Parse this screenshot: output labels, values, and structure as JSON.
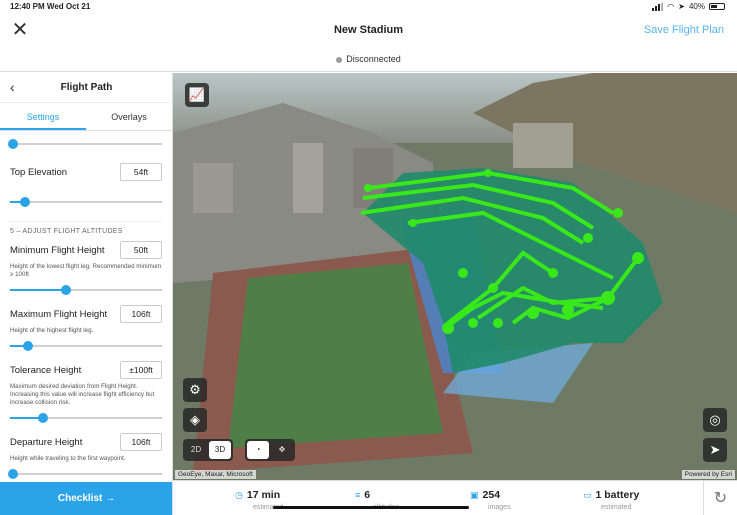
{
  "status_bar": {
    "time_date": "12:40 PM  Wed Oct 21",
    "battery": "40%"
  },
  "header": {
    "title": "New Stadium",
    "save_label": "Save Flight Plan",
    "connection": "Disconnected"
  },
  "sidebar": {
    "title": "Flight Path",
    "tabs": [
      {
        "label": "Settings",
        "active": true
      },
      {
        "label": "Overlays",
        "active": false
      }
    ],
    "sliders": {
      "top": 0.02,
      "top_elevation": 0.1,
      "min_height": 0.37,
      "max_height": 0.12,
      "tolerance": 0.22,
      "departure": 0.02
    },
    "top_elevation": {
      "label": "Top Elevation",
      "value": "54ft"
    },
    "section_title": "5 – ADJUST FLIGHT ALTITUDES",
    "min_height": {
      "label": "Minimum Flight Height",
      "value": "50ft",
      "desc": "Height of the lowest flight leg. Recommended minimum ≥ 100ft"
    },
    "max_height": {
      "label": "Maximum Flight Height",
      "value": "106ft",
      "desc": "Height of the highest flight leg."
    },
    "tolerance": {
      "label": "Tolerance Height",
      "value": "±100ft",
      "desc": "Maximum desired deviation from Flight Height. Increasing this value will increase flight efficiency but increase collision risk."
    },
    "departure": {
      "label": "Departure Height",
      "value": "106ft",
      "desc": "Height while traveling to the first waypoint."
    },
    "checklist_label": "Checklist →"
  },
  "map": {
    "mode_2d": "2D",
    "mode_3d": "3D",
    "active_mode": "3D",
    "attribution_left": "GeoEye, Maxar, Microsoft",
    "attribution_right": "Powered by Esri",
    "icons": [
      "chart-icon",
      "gear-icon",
      "layers-icon",
      "orbit-icon",
      "move-icon",
      "locate-icon",
      "navigate-icon"
    ]
  },
  "footer": {
    "time": {
      "value": "17 min",
      "unit": "estimated"
    },
    "altitudes": {
      "value": "6",
      "unit": "altitudes"
    },
    "images": {
      "value": "254",
      "unit": "images"
    },
    "battery": {
      "value": "1 battery",
      "unit": "estimated"
    }
  },
  "colors": {
    "accent": "#2aa3e8",
    "flight_path": "#39e81a",
    "facade": "#1f8a6a"
  }
}
